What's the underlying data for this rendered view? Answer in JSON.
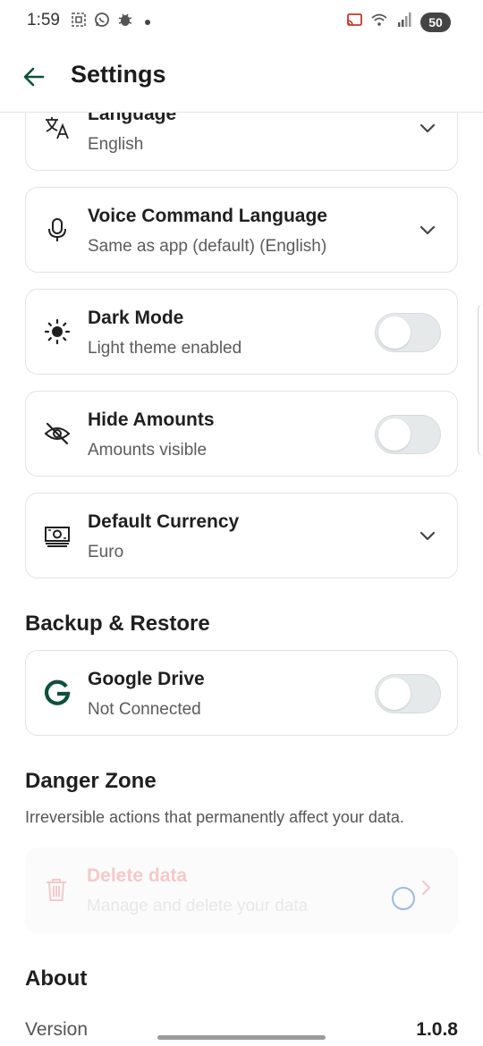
{
  "status_bar": {
    "time": "1:59",
    "battery": "50"
  },
  "app_bar": {
    "title": "Settings"
  },
  "settings": {
    "language": {
      "title": "Language",
      "value": "English"
    },
    "voice": {
      "title": "Voice Command Language",
      "value": "Same as app (default) (English)"
    },
    "dark_mode": {
      "title": "Dark Mode",
      "value": "Light theme enabled",
      "enabled": false
    },
    "hide_amounts": {
      "title": "Hide Amounts",
      "value": "Amounts visible",
      "enabled": false
    },
    "currency": {
      "title": "Default Currency",
      "value": "Euro"
    }
  },
  "backup": {
    "section_title": "Backup & Restore",
    "google_drive": {
      "title": "Google Drive",
      "value": "Not Connected",
      "enabled": false
    }
  },
  "danger": {
    "section_title": "Danger Zone",
    "description": "Irreversible actions that permanently affect your data.",
    "delete": {
      "title": "Delete data",
      "value": "Manage and delete your data"
    }
  },
  "about": {
    "section_title": "About",
    "version_label": "Version",
    "version_value": "1.0.8"
  },
  "colors": {
    "accent": "#0f4f3c",
    "danger_disabled": "#f6c9c9"
  },
  "icons": {
    "language": "translate-icon",
    "voice": "microphone-icon",
    "dark_mode": "sun-icon",
    "hide_amounts": "eye-off-icon",
    "currency": "banknote-icon",
    "google_drive": "google-icon",
    "delete": "trash-icon"
  }
}
